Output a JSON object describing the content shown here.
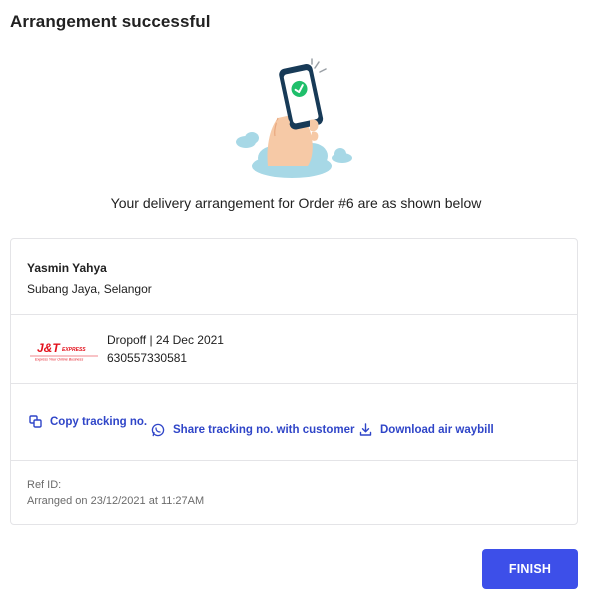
{
  "page": {
    "title": "Arrangement successful",
    "subtitle": "Your delivery arrangement for Order #6 are as shown below"
  },
  "customer": {
    "name": "Yasmin Yahya",
    "address": "Subang Jaya, Selangor"
  },
  "shipment": {
    "courier_logo_text": "J&T EXPRESS",
    "courier_tagline": "Express Your Online Business",
    "method_date": "Dropoff | 24 Dec 2021",
    "tracking_number": "630557330581"
  },
  "actions": {
    "copy_label": "Copy tracking no.",
    "share_label": "Share tracking no. with customer",
    "download_label": "Download air waybill"
  },
  "reference": {
    "ref_label": "Ref ID:",
    "arranged_text": "Arranged on 23/12/2021 at 11:27AM"
  },
  "footer": {
    "finish_label": "FINISH"
  },
  "icons": {
    "illustration": "phone-success-illustration",
    "copy": "copy-icon",
    "share": "whatsapp-icon",
    "download": "download-icon"
  },
  "colors": {
    "accent": "#3d4fe9",
    "link": "#2f45c8",
    "success": "#1fbf6b",
    "courier_red": "#e3101b"
  }
}
